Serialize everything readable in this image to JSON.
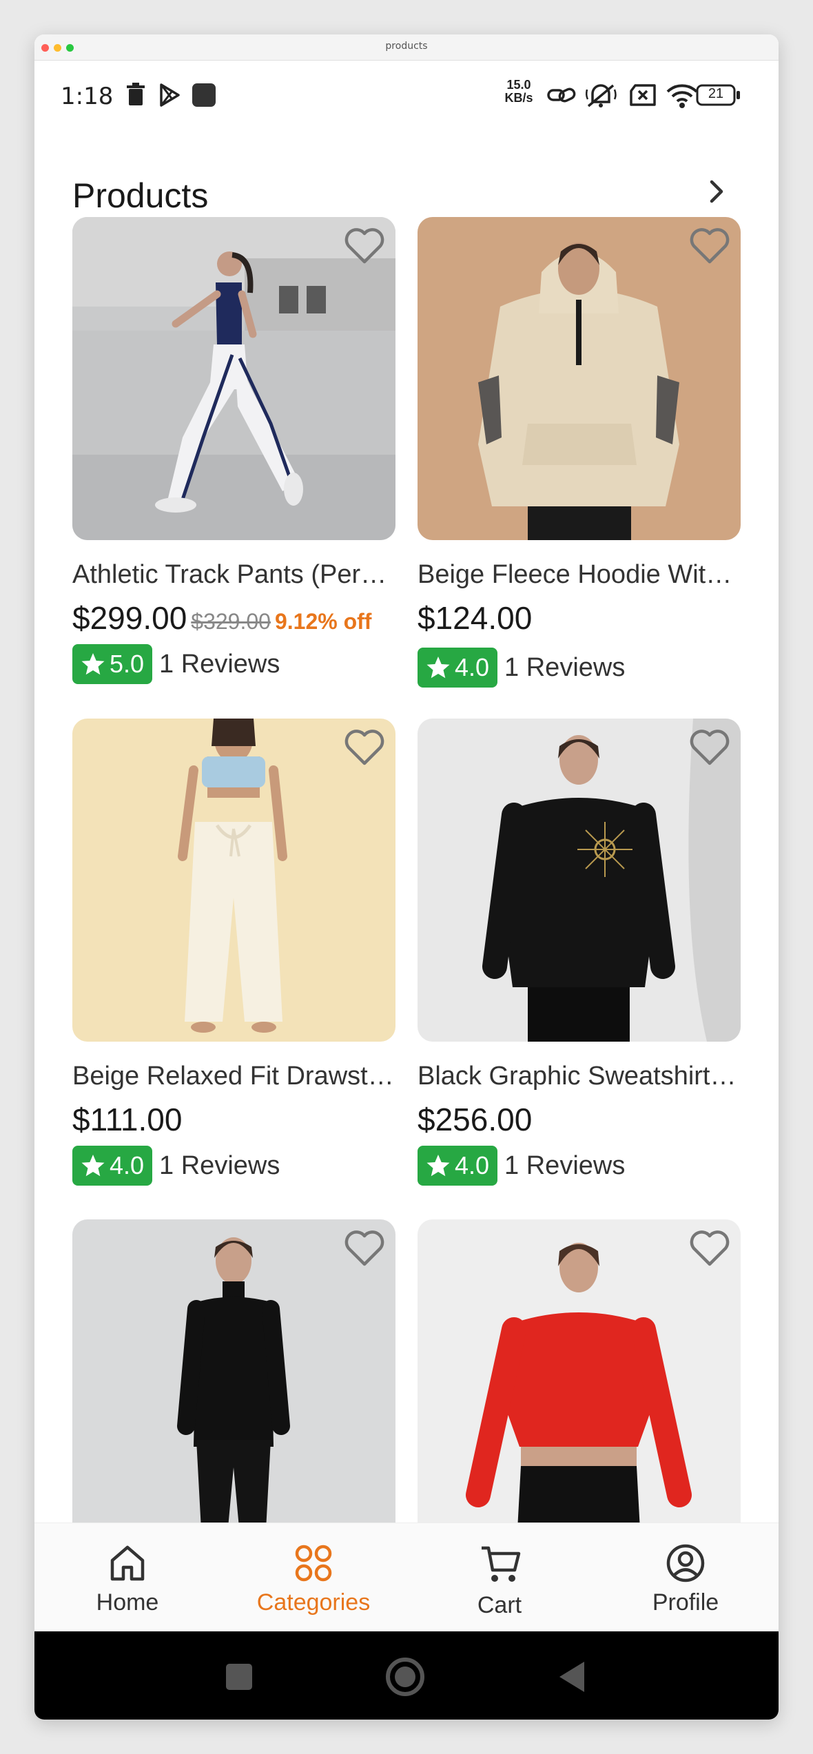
{
  "window": {
    "title": "products"
  },
  "status_bar": {
    "time": "1:18",
    "net_speed_value": "15.0",
    "net_speed_unit": "KB/s",
    "battery": "21"
  },
  "header": {
    "title": "Products"
  },
  "products": [
    {
      "name": "Athletic Track Pants (Per…",
      "price": "$299.00",
      "old_price": "$329.00",
      "discount": "9.12% off",
      "rating": "5.0",
      "reviews": "1 Reviews"
    },
    {
      "name": "Beige Fleece Hoodie Wit…",
      "price": "$124.00",
      "old_price": "",
      "discount": "",
      "rating": "4.0",
      "reviews": "1 Reviews"
    },
    {
      "name": "Beige Relaxed Fit Drawst…",
      "price": "$111.00",
      "old_price": "",
      "discount": "",
      "rating": "4.0",
      "reviews": "1 Reviews"
    },
    {
      "name": "Black Graphic Sweatshirt…",
      "price": "$256.00",
      "old_price": "",
      "discount": "",
      "rating": "4.0",
      "reviews": "1 Reviews"
    },
    {
      "name": "",
      "price": "",
      "old_price": "",
      "discount": "",
      "rating": "",
      "reviews": ""
    },
    {
      "name": "",
      "price": "",
      "old_price": "",
      "discount": "",
      "rating": "",
      "reviews": ""
    }
  ],
  "bottom_nav": {
    "items": [
      {
        "label": "Home",
        "icon": "home-icon"
      },
      {
        "label": "Categories",
        "icon": "categories-icon"
      },
      {
        "label": "Cart",
        "icon": "cart-icon"
      },
      {
        "label": "Profile",
        "icon": "profile-icon"
      }
    ],
    "active": "Categories"
  },
  "colors": {
    "accent": "#e8761c",
    "rating_badge": "#27a843",
    "text": "#1a1a1a"
  }
}
